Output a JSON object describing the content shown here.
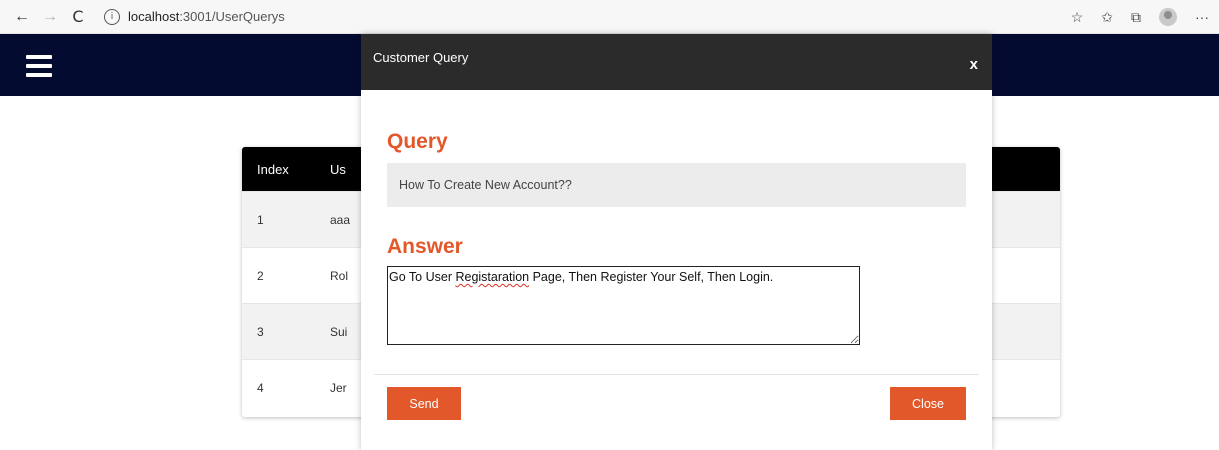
{
  "browser": {
    "url_host": "localhost",
    "url_path": ":3001/UserQuerys",
    "info_icon": "i",
    "back_icon": "←",
    "forward_icon": "→",
    "reload_icon": "C",
    "favorites_add_icon": "☆",
    "favorites_icon": "✩",
    "collections_icon": "⧉",
    "more_icon": "···"
  },
  "table": {
    "headers": {
      "index": "Index",
      "user": "Us"
    },
    "rows": [
      {
        "index": "1",
        "user": "aaa"
      },
      {
        "index": "2",
        "user": "Rol"
      },
      {
        "index": "3",
        "user": "Sui"
      },
      {
        "index": "4",
        "user": "Jer"
      }
    ]
  },
  "modal": {
    "title": "Customer Query",
    "close_x": "x",
    "query_heading": "Query",
    "query_text": "How To Create New Account??",
    "answer_heading": "Answer",
    "answer_text_before": "Go To User ",
    "answer_text_misspelled": "Registaration",
    "answer_text_after": " Page, Then Register Your Self, Then Login.",
    "send_label": "Send",
    "close_label": "Close"
  },
  "colors": {
    "accent": "#e2582a",
    "header_bg": "#040b30",
    "modal_header_bg": "#2b2b2b"
  }
}
